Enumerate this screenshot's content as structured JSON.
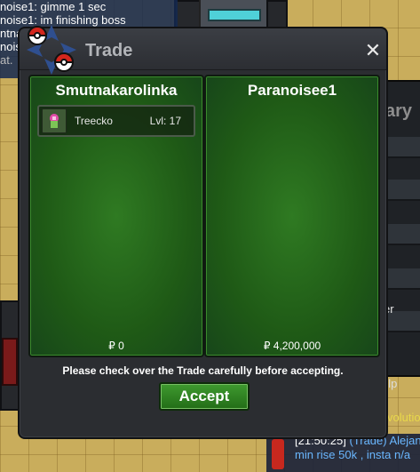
{
  "background": {
    "chat_top": [
      "noise1: gimme 1 sec",
      "noise1: im finishing boss",
      "ntnak",
      "noise",
      "at."
    ],
    "partial_title": "ary",
    "partial_help": "elp",
    "partial_er": "er",
    "partial_evo": "volution",
    "chat_bottom": {
      "time": "[21:50:25]",
      "channel": "(Trade) Alejan",
      "message": "min rise 50k , insta n/a"
    }
  },
  "trade": {
    "title": "Trade",
    "close_symbol": "✕",
    "left": {
      "player": "Smutnakarolinka",
      "items": [
        {
          "name": "Treecko",
          "level": "Lvl: 17",
          "icon": "treecko-sprite-icon"
        }
      ],
      "money": "₽ 0"
    },
    "right": {
      "player": "Paranoisee1",
      "items": [],
      "money": "₽ 4,200,000"
    },
    "warning": "Please check over the Trade carefully before accepting.",
    "accept_label": "Accept",
    "colors": {
      "panel_green": "#2f7a22",
      "button_green": "#3f9a2f",
      "window_bg": "#2b2d31",
      "title_gray": "#b3b5b9"
    }
  }
}
